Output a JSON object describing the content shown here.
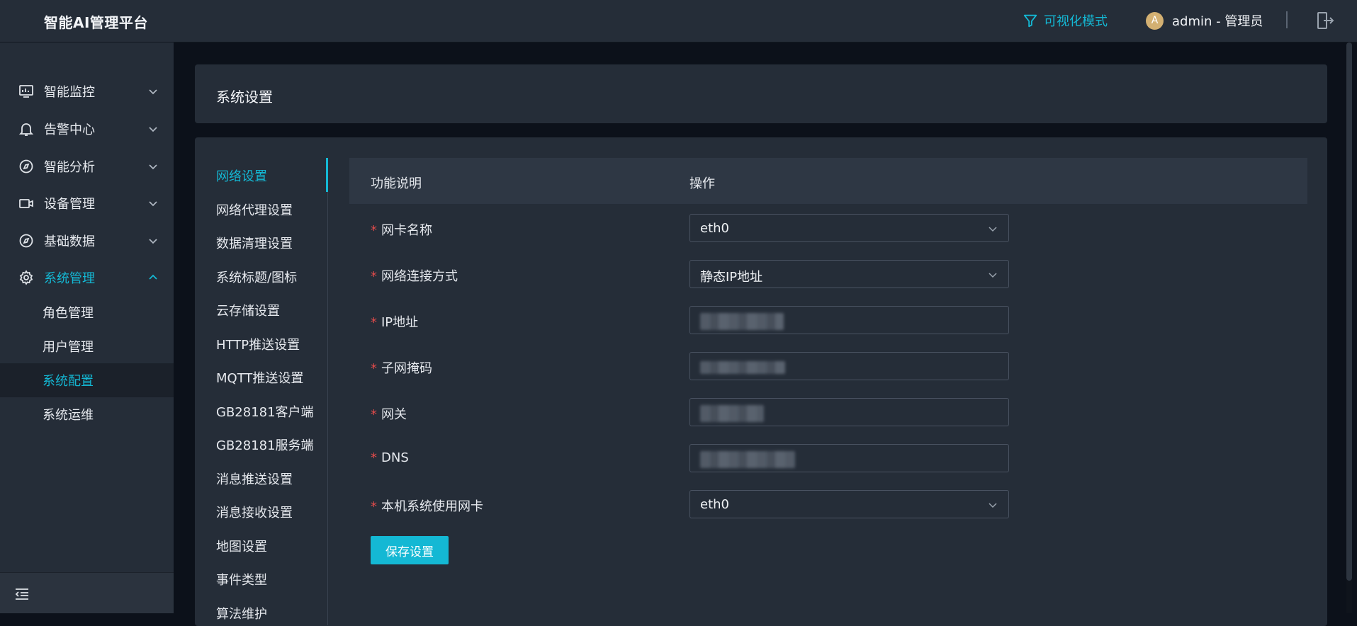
{
  "app": {
    "title": "智能AI管理平台"
  },
  "topbar": {
    "viz_mode_label": "可视化模式",
    "avatar_letter": "A",
    "user_label": "admin - 管理员",
    "accent_color": "#14b8d4"
  },
  "sidebar": {
    "items": [
      {
        "label": "智能监控",
        "icon": "monitor-icon",
        "expanded": false
      },
      {
        "label": "告警中心",
        "icon": "bell-icon",
        "expanded": false
      },
      {
        "label": "智能分析",
        "icon": "compass-icon",
        "expanded": false
      },
      {
        "label": "设备管理",
        "icon": "camera-icon",
        "expanded": false
      },
      {
        "label": "基础数据",
        "icon": "compass-icon",
        "expanded": false
      },
      {
        "label": "系统管理",
        "icon": "gear-icon",
        "expanded": true,
        "active": true
      }
    ],
    "subitems": [
      {
        "label": "角色管理"
      },
      {
        "label": "用户管理"
      },
      {
        "label": "系统配置",
        "active": true
      },
      {
        "label": "系统运维"
      }
    ]
  },
  "page": {
    "title": "系统设置"
  },
  "settings_nav": {
    "items": [
      "网络设置",
      "网络代理设置",
      "数据清理设置",
      "系统标题/图标",
      "云存储设置",
      "HTTP推送设置",
      "MQTT推送设置",
      "GB28181客户端",
      "GB28181服务端",
      "消息推送设置",
      "消息接收设置",
      "地图设置",
      "事件类型",
      "算法维护"
    ],
    "active_index": 0
  },
  "table": {
    "col_description": "功能说明",
    "col_operation": "操作"
  },
  "form": {
    "required_mark": "*",
    "rows": [
      {
        "label": "网卡名称",
        "type": "select",
        "value": "eth0"
      },
      {
        "label": "网络连接方式",
        "type": "select",
        "value": "静态IP地址"
      },
      {
        "label": "IP地址",
        "type": "input",
        "value": ""
      },
      {
        "label": "子网掩码",
        "type": "input",
        "value": ""
      },
      {
        "label": "网关",
        "type": "input",
        "value": ""
      },
      {
        "label": "DNS",
        "type": "input",
        "value": ""
      },
      {
        "label": "本机系统使用网卡",
        "type": "select",
        "value": "eth0"
      }
    ],
    "save_label": "保存设置"
  }
}
